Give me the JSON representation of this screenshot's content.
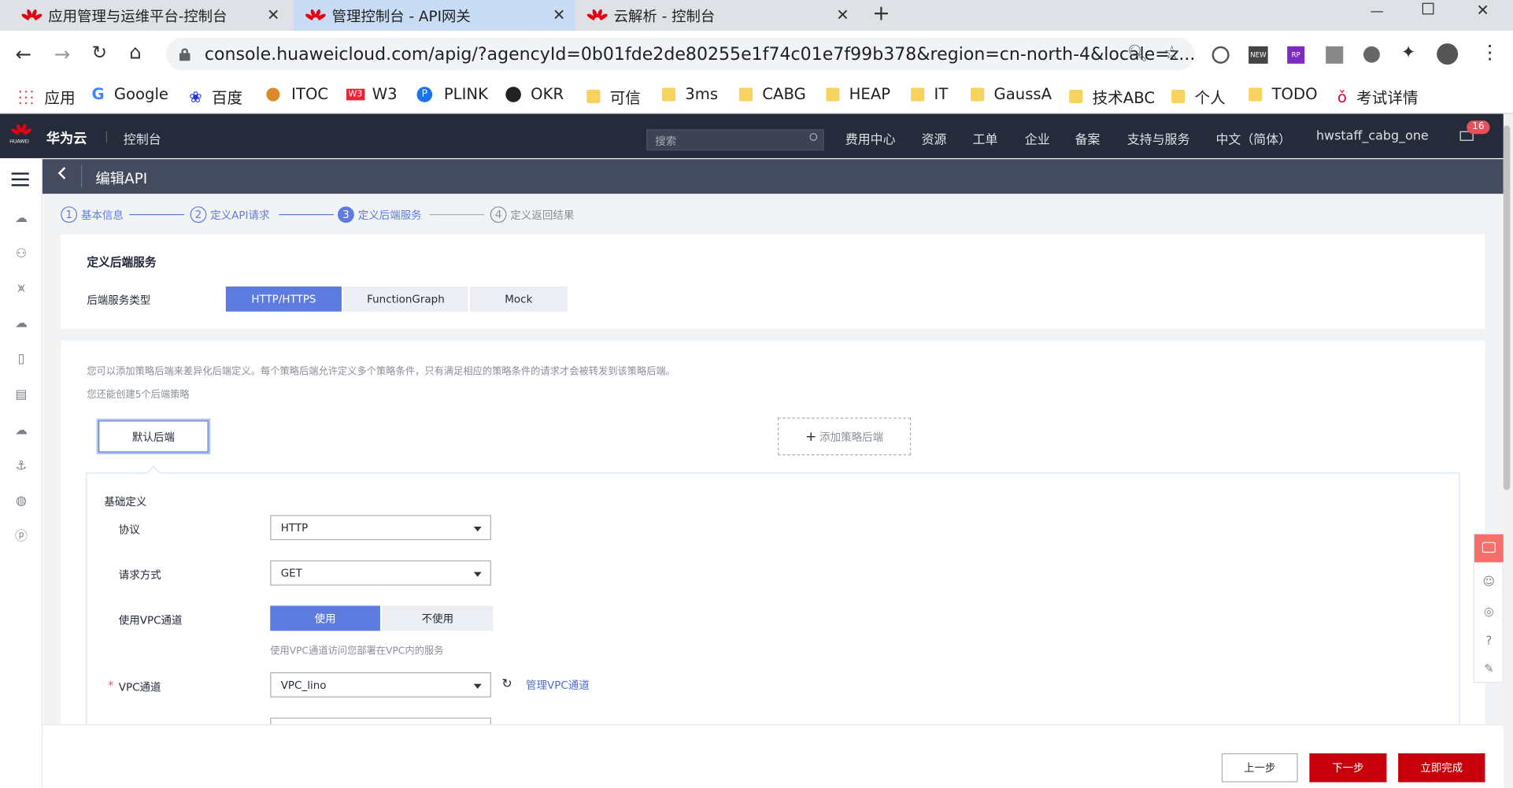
{
  "browser": {
    "tabs": [
      {
        "title": "应用管理与运维平台-控制台"
      },
      {
        "title": "管理控制台 - API网关"
      },
      {
        "title": "云解析 - 控制台"
      }
    ],
    "new_tab": "+",
    "url": "console.huaweicloud.com/apig/?agencyId=0b01fde2de80255e1f74c01e7f99b378&region=cn-north-4&locale=z...",
    "bookmarks": [
      "应用",
      "Google",
      "百度",
      "ITOC",
      "W3",
      "PLINK",
      "OKR",
      "可信",
      "3ms",
      "CABG",
      "HEAP",
      "IT",
      "GaussA",
      "技术ABC",
      "个人",
      "TODO",
      "考试详情"
    ]
  },
  "topnav": {
    "brand": "华为云",
    "brand_sub": "HUAWEI",
    "console": "控制台",
    "search_placeholder": "搜索",
    "items": [
      "费用中心",
      "资源",
      "工单",
      "企业",
      "备案",
      "支持与服务",
      "中文（简体）",
      "hwstaff_cabg_one"
    ],
    "badge": "16"
  },
  "page": {
    "title": "编辑API",
    "steps": [
      {
        "num": "1",
        "label": "基本信息"
      },
      {
        "num": "2",
        "label": "定义API请求"
      },
      {
        "num": "3",
        "label": "定义后端服务"
      },
      {
        "num": "4",
        "label": "定义返回结果"
      }
    ],
    "section_title": "定义后端服务",
    "backend_type_label": "后端服务类型",
    "backend_types": [
      "HTTP/HTTPS",
      "FunctionGraph",
      "Mock"
    ],
    "info_line1": "您可以添加策略后端来差异化后端定义。每个策略后端允许定义多个策略条件，只有满足相应的策略条件的请求才会被转发到该策略后端。",
    "info_line2": "您还能创建5个后端策略",
    "default_backend": "默认后端",
    "add_policy_backend": "添加策略后端",
    "basic_def": "基础定义",
    "protocol_label": "协议",
    "protocol_value": "HTTP",
    "method_label": "请求方式",
    "method_value": "GET",
    "vpc_use_label": "使用VPC通道",
    "vpc_use_options": [
      "使用",
      "不使用"
    ],
    "vpc_hint": "使用VPC通道访问您部署在VPC内的服务",
    "vpc_channel_label": "VPC通道",
    "vpc_channel_value": "VPC_lino",
    "manage_vpc": "管理VPC通道",
    "required_mark": "*"
  },
  "footer": {
    "prev": "上一步",
    "next": "下一步",
    "finish": "立即完成"
  },
  "colors": {
    "accent": "#5e7ce0",
    "danger": "#c7000b",
    "nav_bg": "#252b3a",
    "header_bg": "#454b5f"
  }
}
